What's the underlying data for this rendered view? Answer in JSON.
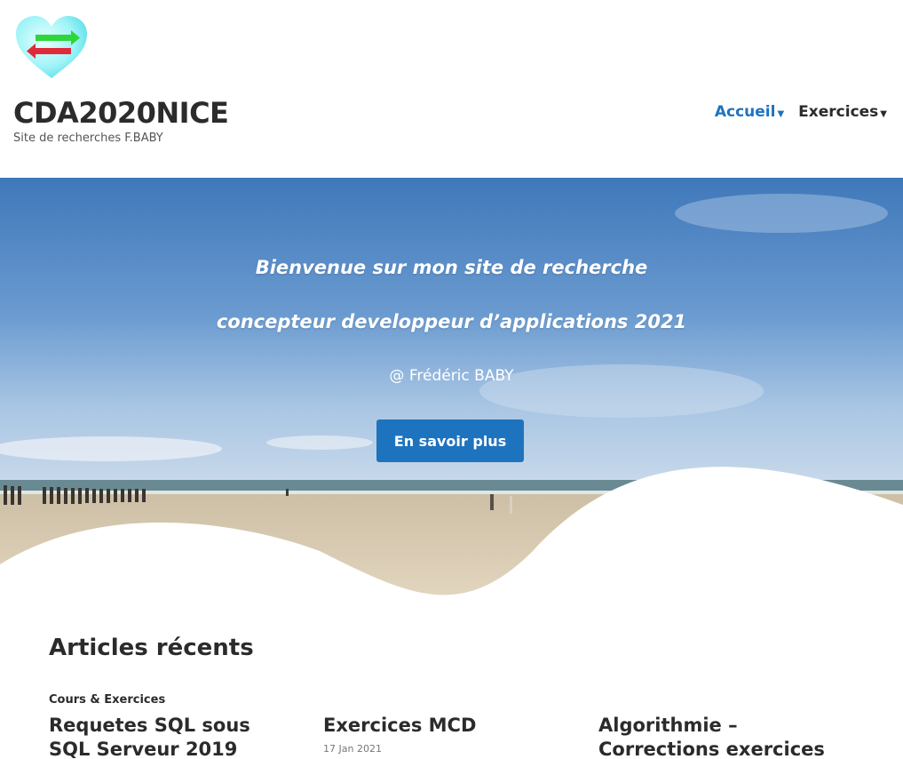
{
  "header": {
    "site_title": "CDA2020NICE",
    "tagline": "Site de recherches F.BABY",
    "nav": [
      {
        "label": "Accueil",
        "active": true
      },
      {
        "label": "Exercices",
        "active": false
      }
    ]
  },
  "hero": {
    "line1": "Bienvenue sur mon site de recherche",
    "line2": "concepteur developpeur d’applications 2021",
    "author": "@ Frédéric BABY",
    "cta_label": "En savoir plus"
  },
  "recent": {
    "title": "Articles récents",
    "posts": [
      {
        "category": "Cours & Exercices",
        "title": "Requetes SQL sous SQL Serveur 2019"
      },
      {
        "category": "",
        "title": "Exercices MCD",
        "date": "17 Jan 2021"
      },
      {
        "category": "",
        "title": "Algorithmie – Corrections exercices"
      }
    ]
  },
  "colors": {
    "accent": "#1e73be",
    "text": "#2b2b2b"
  },
  "icons": {
    "logo": "heart-arrows-logo-icon",
    "caret": "caret-down-icon"
  }
}
